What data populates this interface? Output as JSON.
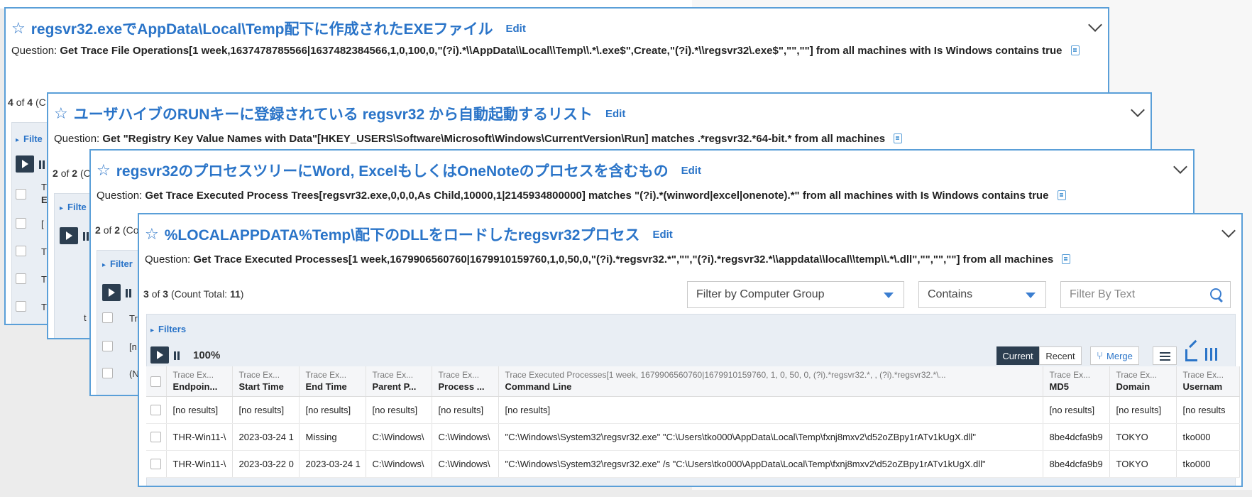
{
  "cards": [
    {
      "title": "regsvr32.exeでAppData\\Local\\Temp配下に作成されたEXEファイル",
      "edit": "Edit",
      "question_prefix": "Question:",
      "question": "Get Trace File Operations[1 week,1637478785566|1637482384566,1,0,100,0,\"(?i).*\\\\AppData\\\\Local\\\\Temp\\\\.*\\.exe$\",Create,\"(?i).*\\\\regsvr32\\.exe$\",\"\",\"\"] from all machines with Is Windows contains true",
      "count_cur": "4",
      "count_of": "of",
      "count_tot": "4",
      "count_paren": "(C",
      "filters_frag": "Filte",
      "rows_frag": [
        "[",
        "T",
        "T",
        "T"
      ],
      "header_frag": "T\nE"
    },
    {
      "title": "ユーザハイブのRUNキーに登録されている regsvr32 から自動起動するリスト",
      "edit": "Edit",
      "question_prefix": "Question:",
      "question": "Get \"Registry Key Value Names with Data\"[HKEY_USERS\\Software\\Microsoft\\Windows\\CurrentVersion\\Run] matches .*regsvr32.*64-bit.* from all machines",
      "count_cur": "2",
      "count_of": "of",
      "count_tot": "2",
      "count_paren": "(C",
      "filters_frag": "Filte",
      "rows_frag": [
        "t"
      ]
    },
    {
      "title": "regsvr32のプロセスツリーにWord, ExcelもしくはOneNoteのプロセスを含むもの",
      "edit": "Edit",
      "question_prefix": "Question:",
      "question": "Get Trace Executed Process Trees[regsvr32.exe,0,0,0,As Child,10000,1|2145934800000] matches \"(?i).*(winword|excel|onenote).*\" from all machines with Is Windows contains true",
      "count_cur": "2",
      "count_of": "of",
      "count_tot": "2",
      "count_paren": "(Co",
      "filters_frag": "Filter",
      "rows_frag": [
        "Tr",
        "[n",
        "(N"
      ]
    },
    {
      "title": "%LOCALAPPDATA%Temp\\配下のDLLをロードしたregsvr32プロセス",
      "edit": "Edit",
      "question_prefix": "Question:",
      "question": "Get Trace Executed Processes[1 week,1679906560760|1679910159760,1,0,50,0,\"(?i).*regsvr32.*\",\"\",\"(?i).*regsvr32.*\\\\appdata\\\\local\\\\temp\\\\.*\\.dll\",\"\",\"\",\"\"] from all machines",
      "count_cur": "3",
      "count_of": "of",
      "count_tot": "3",
      "count_total_label": "(Count Total:",
      "count_total_value": "11",
      "count_total_close": ")",
      "filter_group": "Filter by Computer Group",
      "contains": "Contains",
      "filter_text_placeholder": "Filter By Text",
      "filters": "Filters",
      "progress": "100%",
      "current": "Current",
      "recent": "Recent",
      "merge": "Merge",
      "columns": [
        {
          "top": "Trace Ex...",
          "bottom": "Endpoin..."
        },
        {
          "top": "Trace Ex...",
          "bottom": "Start Time"
        },
        {
          "top": "Trace Ex...",
          "bottom": "End Time"
        },
        {
          "top": "Trace Ex...",
          "bottom": "Parent P..."
        },
        {
          "top": "Trace Ex...",
          "bottom": "Process ..."
        },
        {
          "top": "Trace Executed Processes[1 week, 1679906560760|1679910159760, 1, 0, 50, 0, (?i).*regsvr32.*, , (?i).*regsvr32.*\\...",
          "bottom": "Command Line"
        },
        {
          "top": "Trace Ex...",
          "bottom": "MD5"
        },
        {
          "top": "Trace Ex...",
          "bottom": "Domain"
        },
        {
          "top": "Trace Ex...",
          "bottom": "Usernam"
        }
      ],
      "rows": [
        [
          "[no results]",
          "[no results]",
          "[no results]",
          "[no results]",
          "[no results]",
          "[no results]",
          "[no results]",
          "[no results]",
          "[no results"
        ],
        [
          "THR-Win11-\\",
          "2023-03-24 1",
          "Missing",
          "C:\\Windows\\",
          "C:\\Windows\\",
          "\"C:\\Windows\\System32\\regsvr32.exe\" \"C:\\Users\\tko000\\AppData\\Local\\Temp\\fxnj8mxv2\\d52oZBpy1rATv1kUgX.dll\"",
          "8be4dcfa9b9",
          "TOKYO",
          "tko000"
        ],
        [
          "THR-Win11-\\",
          "2023-03-22 0",
          "2023-03-24 1",
          "C:\\Windows\\",
          "C:\\Windows\\",
          "\"C:\\Windows\\System32\\regsvr32.exe\" /s \"C:\\Users\\tko000\\AppData\\Local\\Temp\\fxnj8mxv2\\d52oZBpy1rATv1kUgX.dll\"",
          "8be4dcfa9b9",
          "TOKYO",
          "tko000"
        ]
      ]
    }
  ]
}
